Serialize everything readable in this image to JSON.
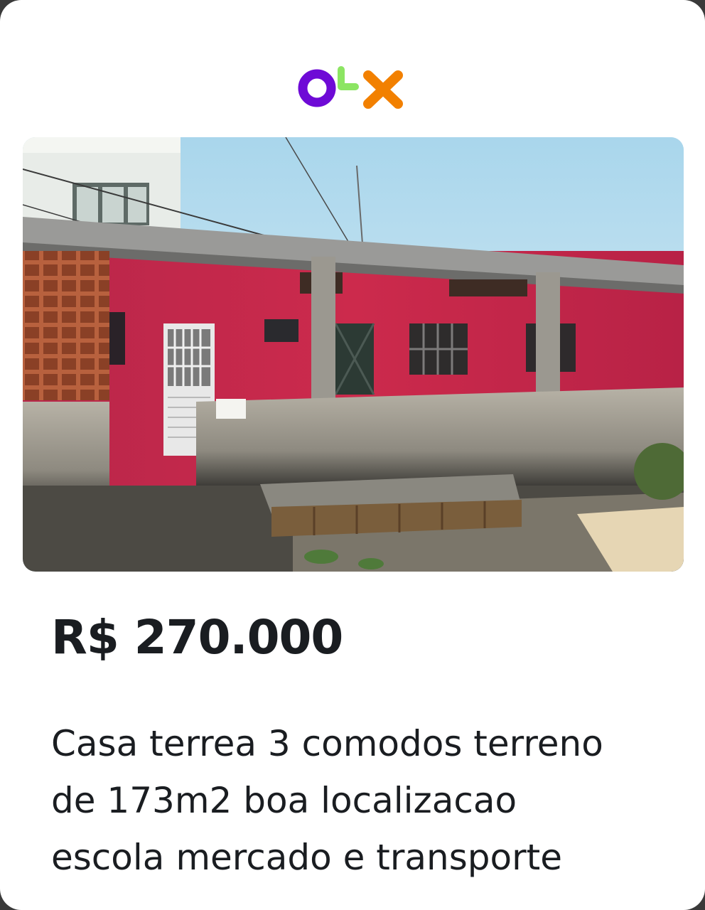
{
  "logo": {
    "icon": "olx-logo-icon",
    "text": "OLX",
    "colors": {
      "o": "#6e0ad6",
      "l": "#8ce563",
      "x": "#f28000"
    }
  },
  "listing": {
    "photo": "house-photo",
    "price": "R$ 270.000",
    "description_lines": [
      "Casa terrea 3 comodos terreno",
      "de 173m2 boa localizacao",
      "escola mercado e transporte"
    ]
  },
  "colors": {
    "card_bg": "#ffffff",
    "text": "#1a1d21",
    "wall": "#c8244a"
  }
}
